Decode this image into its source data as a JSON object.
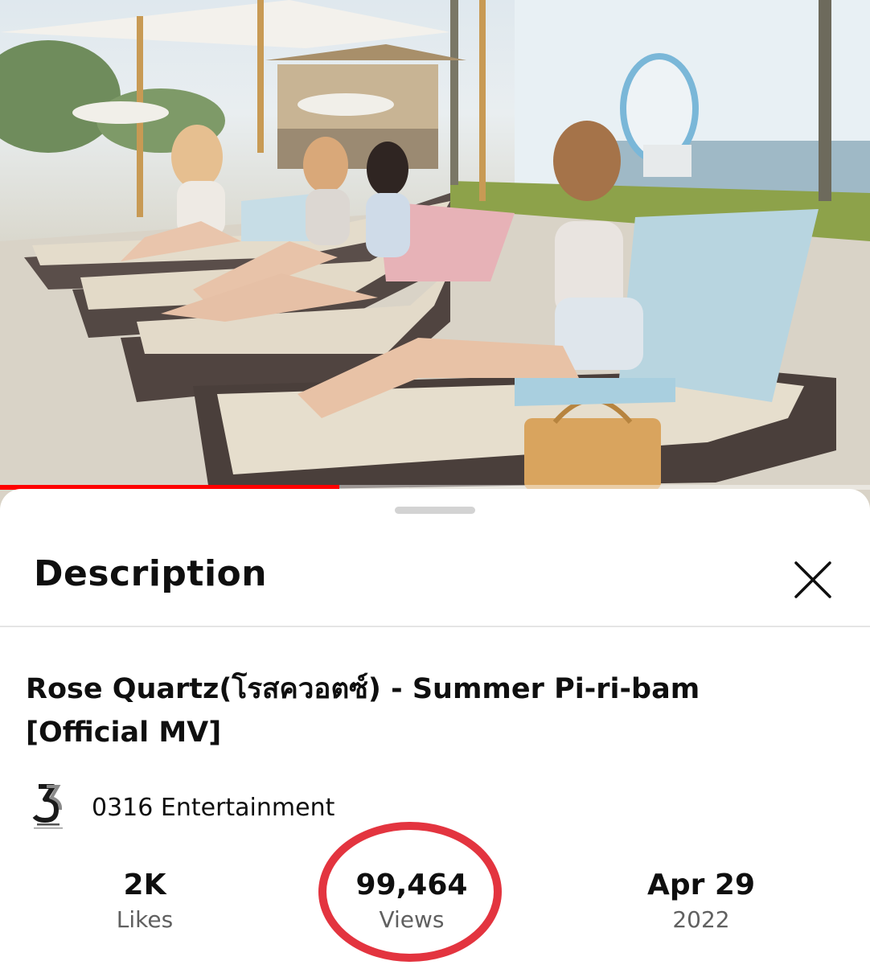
{
  "video": {
    "progress_fraction": 0.39,
    "accent_color": "#ff0000"
  },
  "sheet": {
    "title": "Description",
    "close_icon": "close-icon"
  },
  "details": {
    "title": "Rose Quartz(โรสควอตซ์) - Summer Pi-ri-bam [Official MV]",
    "channel": {
      "name": "0316 Entertainment",
      "avatar_icon": "channel-logo-icon"
    },
    "stats": {
      "likes_value": "2K",
      "likes_label": "Likes",
      "views_value": "99,464",
      "views_label": "Views",
      "date_value": "Apr 29",
      "date_label": "2022"
    }
  },
  "annotation": {
    "highlight_color": "#e3343f",
    "highlight_target": "views"
  }
}
